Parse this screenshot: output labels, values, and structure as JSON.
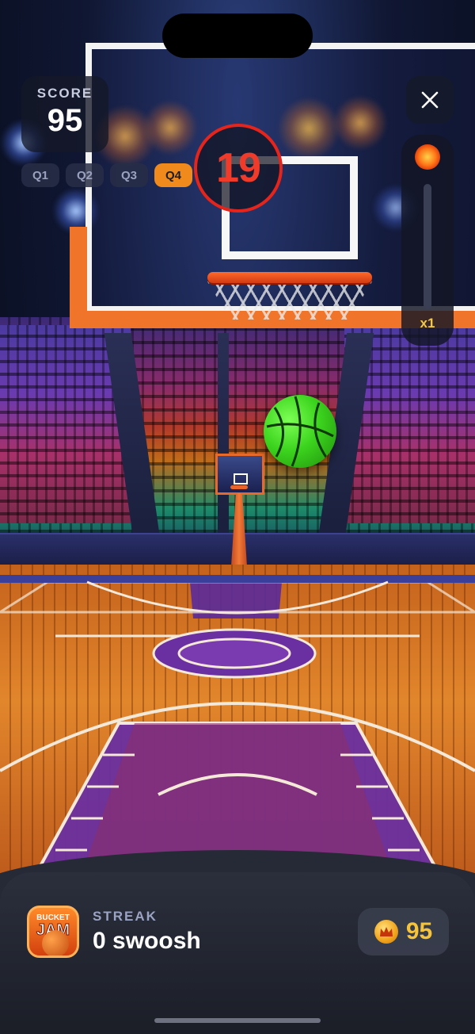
{
  "hud": {
    "score_label": "SCORE",
    "score_value": "95",
    "quarters": [
      "Q1",
      "Q2",
      "Q3",
      "Q4"
    ],
    "active_quarter": "Q4",
    "timer_value": "19",
    "multiplier": "x1"
  },
  "footer": {
    "app_icon_text_top": "BUCKET",
    "app_icon_text_main": "JAM",
    "streak_label": "STREAK",
    "streak_value": "0 swoosh",
    "coins_value": "95"
  },
  "icons": {
    "close": "close-icon",
    "fireball": "fireball-icon",
    "coin": "coin-icon"
  },
  "colors": {
    "active_quarter": "#f08a1c",
    "timer_ring": "#e5241c",
    "timer_text": "#f03a2a",
    "ball": "#3cd41e",
    "coin_text": "#f5c43a",
    "multiplier_text": "#f2c84a"
  }
}
